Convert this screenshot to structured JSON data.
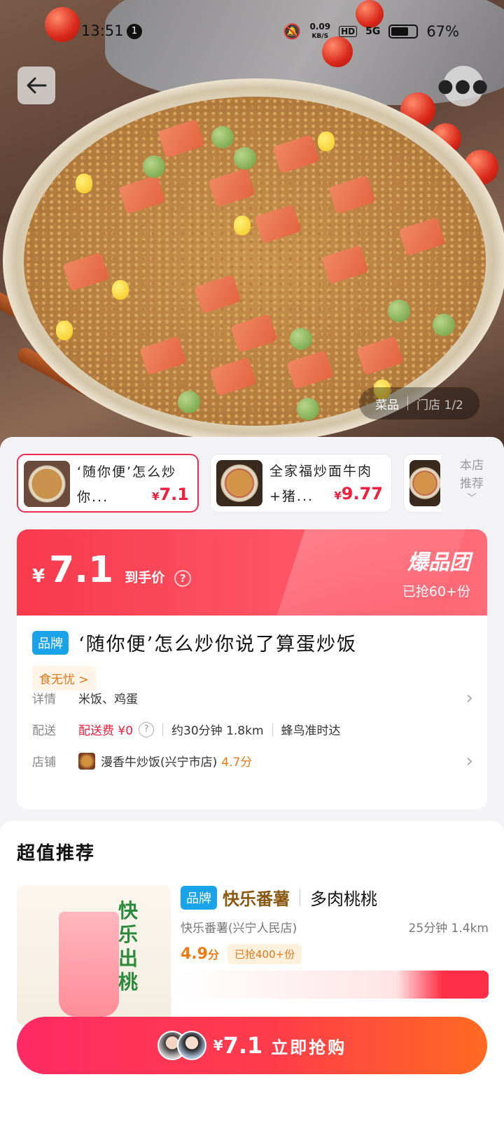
{
  "status_bar": {
    "time": "13:51",
    "notification_count": "1",
    "net_speed": "0.09",
    "net_unit": "KB/S",
    "hd": "HD",
    "signal": "5G",
    "battery": "67%"
  },
  "hero": {
    "photo_tag_left": "菜品",
    "photo_tag_right": "门店 1/2"
  },
  "thumbs": [
    {
      "name": "‘随你便’怎么炒你...",
      "yen": "¥",
      "price": "7.1"
    },
    {
      "name": "全家福炒面牛肉+猪...",
      "yen": "¥",
      "price": "9.77"
    }
  ],
  "store_recommend": "本店推荐",
  "price_card": {
    "yen": "¥",
    "price": "7.1",
    "price_label": "到手价",
    "badge": "爆品团",
    "grabbed": "已抢60+份"
  },
  "product": {
    "brand_tag": "品牌",
    "title": "‘随你便’怎么炒你说了算蛋炒饭",
    "cert": "食无忧 >",
    "details_key": "详情",
    "details_value": "米饭、鸡蛋",
    "delivery_key": "配送",
    "delivery_fee": "配送费 ¥0",
    "delivery_time": "约30分钟 1.8km",
    "delivery_service": "蜂鸟准时达",
    "shop_key": "店铺",
    "shop_name": "漫香牛炒饭(兴宁市店)",
    "shop_score": "4.7分"
  },
  "recommend": {
    "section_title": "超值推荐",
    "img_text": "快乐出桃",
    "brand_tag": "品牌",
    "brand_name": "快乐番薯",
    "item_name": "多肉桃桃",
    "store": "快乐番薯(兴宁人民店)",
    "eta": "25分钟 1.4km",
    "score": "4.9",
    "score_unit": "分",
    "grabbed": "已抢400+份"
  },
  "buy_bar": {
    "yen": "¥",
    "price": "7.1",
    "label": "立即抢购"
  },
  "colors": {
    "accent": "#ee1e3c",
    "brand_blue": "#1aa3e8",
    "orange": "#ef7a14"
  }
}
